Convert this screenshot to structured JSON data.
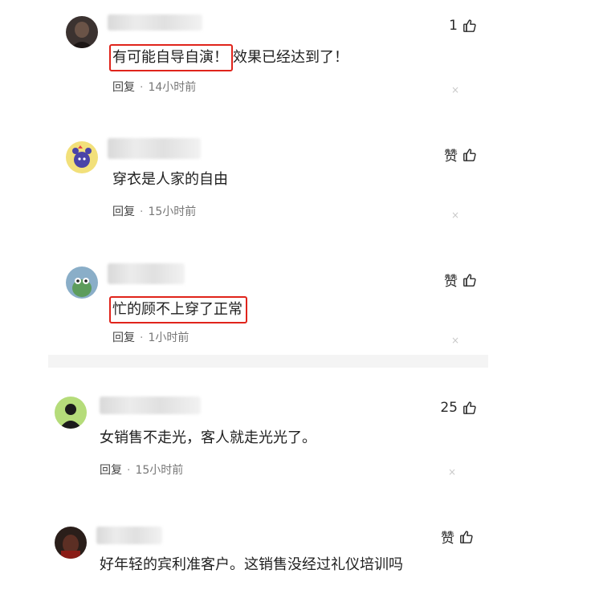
{
  "comments": [
    {
      "likes": "1",
      "text_highlight": "有可能自导自演！",
      "text_rest": "效果已经达到了！",
      "reply": "回复",
      "sep": "·",
      "time": "14小时前",
      "close": "×"
    },
    {
      "likes": "赞",
      "text_highlight": "",
      "text_rest": "穿衣是人家的自由",
      "reply": "回复",
      "sep": "·",
      "time": "15小时前",
      "close": "×"
    },
    {
      "likes": "赞",
      "text_highlight": "忙的顾不上穿了正常",
      "text_rest": "",
      "reply": "回复",
      "sep": "·",
      "time": "1小时前",
      "close": "×"
    },
    {
      "likes": "25",
      "text_highlight": "",
      "text_rest": "女销售不走光，客人就走光光了。",
      "reply": "回复",
      "sep": "·",
      "time": "15小时前",
      "close": "×"
    },
    {
      "likes": "赞",
      "text_highlight": "",
      "text_rest": "好年轻的宾利准客户。这销售没经过礼仪培训吗",
      "reply": "",
      "sep": "",
      "time": "",
      "close": ""
    }
  ],
  "icons": {
    "like": "thumbs-up-icon",
    "close": "close-icon"
  },
  "colors": {
    "highlight_border": "#e0241b",
    "meta_text": "#777777",
    "separator_band": "#f4f4f4"
  }
}
